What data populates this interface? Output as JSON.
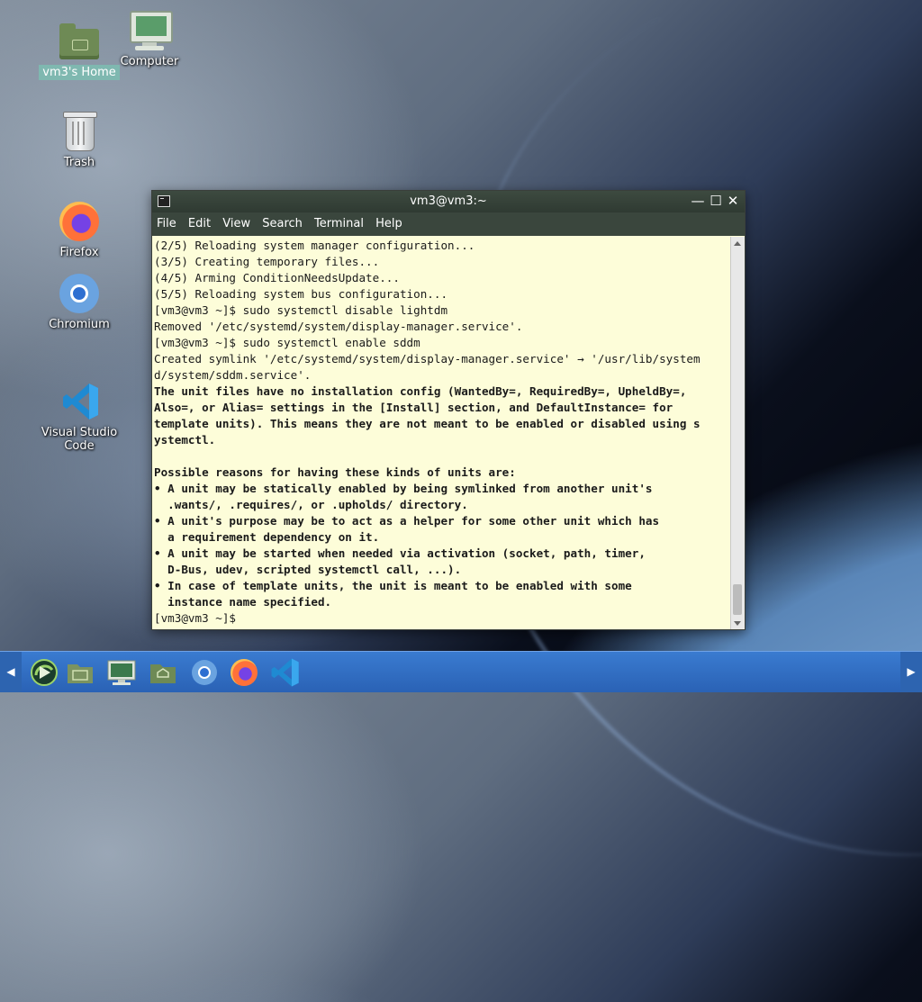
{
  "desktop": {
    "icons": [
      {
        "label": "vm3's Home",
        "icon": "home-folder-icon"
      },
      {
        "label": "Computer",
        "icon": "computer-icon"
      },
      {
        "label": "Trash",
        "icon": "trash-icon"
      },
      {
        "label": "Firefox",
        "icon": "firefox-icon"
      },
      {
        "label": "Chromium",
        "icon": "chromium-icon"
      },
      {
        "label": "Visual Studio Code",
        "icon": "vscode-icon"
      }
    ]
  },
  "terminal": {
    "title": "vm3@vm3:~",
    "menu": [
      "File",
      "Edit",
      "View",
      "Search",
      "Terminal",
      "Help"
    ],
    "lines": [
      {
        "text": "(2/5) Reloading system manager configuration...",
        "bold": false
      },
      {
        "text": "(3/5) Creating temporary files...",
        "bold": false
      },
      {
        "text": "(4/5) Arming ConditionNeedsUpdate...",
        "bold": false
      },
      {
        "text": "(5/5) Reloading system bus configuration...",
        "bold": false
      },
      {
        "text": "[vm3@vm3 ~]$ sudo systemctl disable lightdm",
        "bold": false
      },
      {
        "text": "Removed '/etc/systemd/system/display-manager.service'.",
        "bold": false
      },
      {
        "text": "[vm3@vm3 ~]$ sudo systemctl enable sddm",
        "bold": false
      },
      {
        "text": "Created symlink '/etc/systemd/system/display-manager.service' → '/usr/lib/system",
        "bold": false
      },
      {
        "text": "d/system/sddm.service'.",
        "bold": false
      },
      {
        "text": "The unit files have no installation config (WantedBy=, RequiredBy=, UpheldBy=,",
        "bold": true
      },
      {
        "text": "Also=, or Alias= settings in the [Install] section, and DefaultInstance= for",
        "bold": true
      },
      {
        "text": "template units). This means they are not meant to be enabled or disabled using s",
        "bold": true
      },
      {
        "text": "ystemctl.",
        "bold": true
      },
      {
        "text": "",
        "bold": true
      },
      {
        "text": "Possible reasons for having these kinds of units are:",
        "bold": true
      },
      {
        "text": "• A unit may be statically enabled by being symlinked from another unit's",
        "bold": true
      },
      {
        "text": "  .wants/, .requires/, or .upholds/ directory.",
        "bold": true
      },
      {
        "text": "• A unit's purpose may be to act as a helper for some other unit which has",
        "bold": true
      },
      {
        "text": "  a requirement dependency on it.",
        "bold": true
      },
      {
        "text": "• A unit may be started when needed via activation (socket, path, timer,",
        "bold": true
      },
      {
        "text": "  D-Bus, udev, scripted systemctl call, ...).",
        "bold": true
      },
      {
        "text": "• In case of template units, the unit is meant to be enabled with some",
        "bold": true
      },
      {
        "text": "  instance name specified.",
        "bold": true
      },
      {
        "text": "[vm3@vm3 ~]$ ",
        "bold": false
      }
    ],
    "buttons": {
      "minimize": "—",
      "maximize": "☐",
      "close": "✕"
    }
  },
  "taskbar": {
    "left_arrow": "◀",
    "right_arrow": "▶",
    "items": [
      "start-menu-icon",
      "files-icon",
      "computer-icon",
      "home-folder-icon",
      "chromium-icon",
      "firefox-icon",
      "vscode-icon"
    ]
  },
  "colors": {
    "terminal_bg": "#fdfdd9",
    "titlebar": "#2f3a32",
    "taskbar": "#2a62b5"
  }
}
